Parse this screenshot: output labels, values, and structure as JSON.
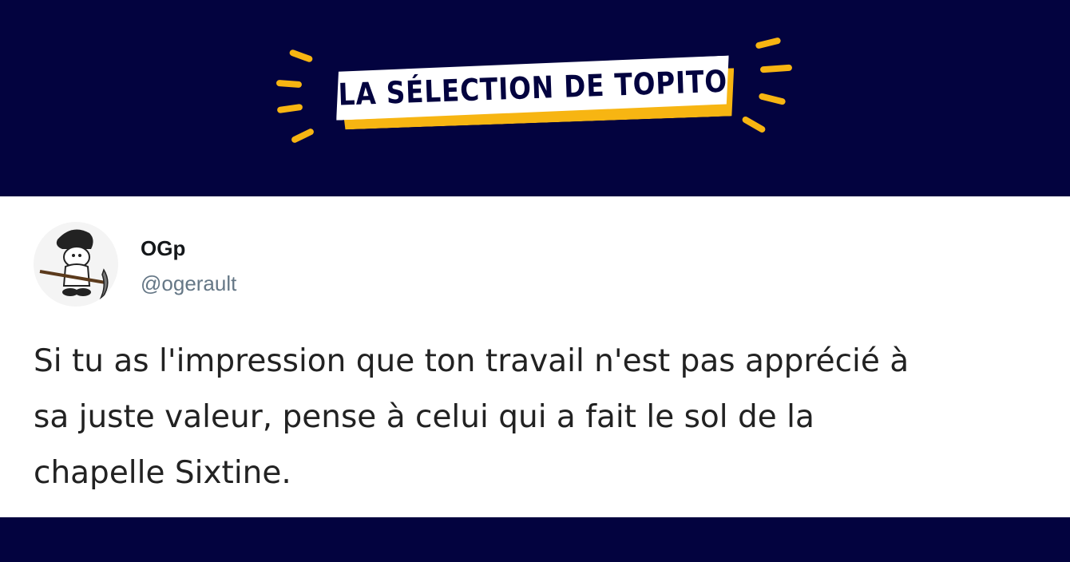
{
  "banner": {
    "title": "LA SÉLECTION DE TOPITO",
    "colors": {
      "background": "#03033f",
      "accent": "#f7b512",
      "badge": "#ffffff"
    }
  },
  "tweet": {
    "avatar_icon": "smurf-reaper-avatar",
    "display_name": "OGp",
    "handle": "@ogerault",
    "lines": [
      "Si tu as l'impression que ton travail n'est pas apprécié à",
      "sa juste valeur, pense à celui qui a fait le sol de la",
      "chapelle Sixtine."
    ]
  }
}
